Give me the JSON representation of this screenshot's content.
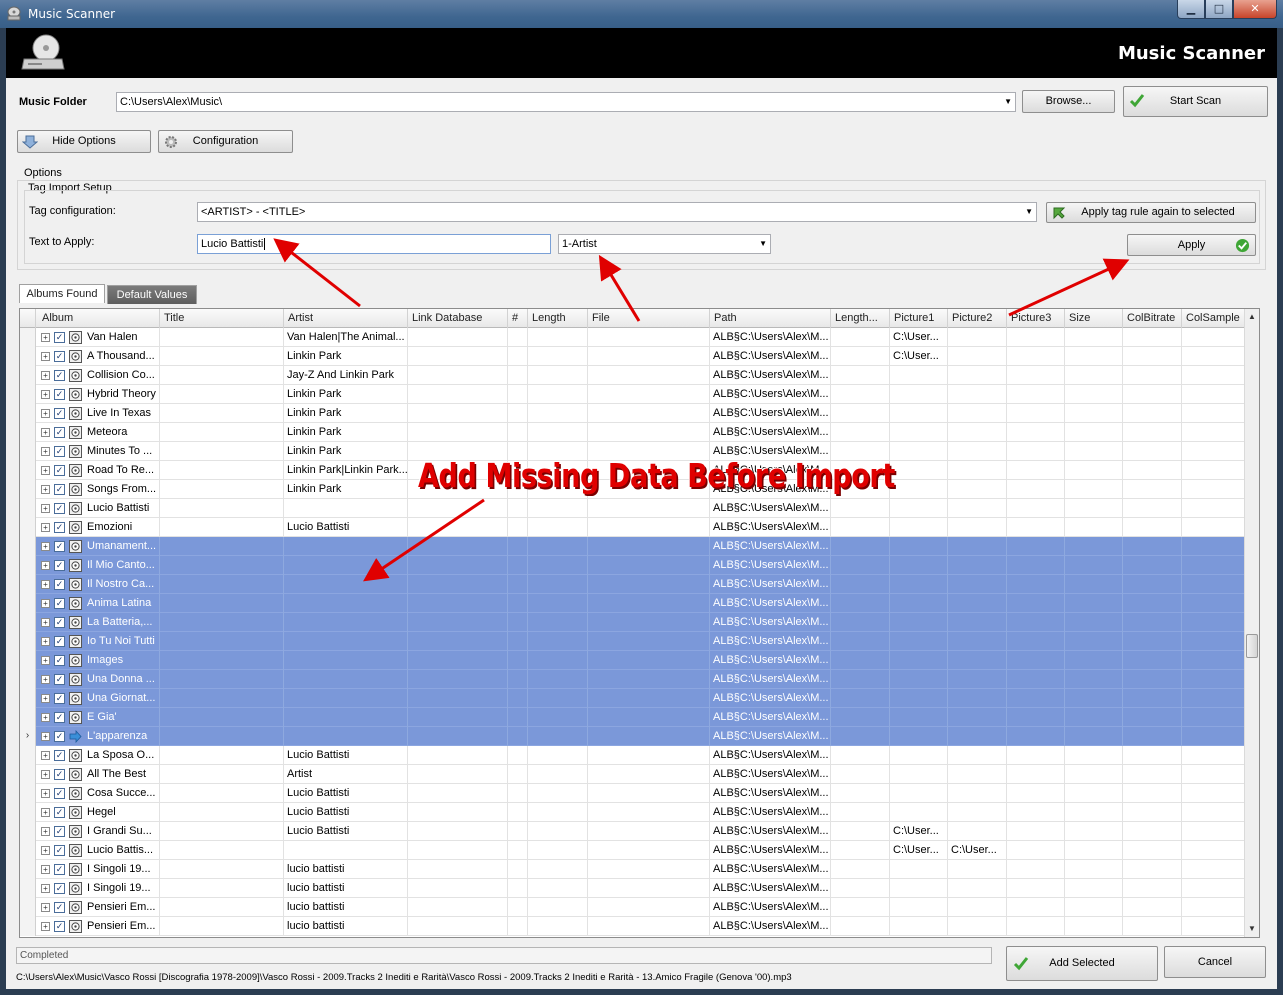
{
  "window": {
    "title": "Music Scanner"
  },
  "header": {
    "brand": "Music Scanner"
  },
  "folder": {
    "label": "Music Folder",
    "value": "C:\\Users\\Alex\\Music\\",
    "browse_label": "Browse...",
    "start_label": "Start Scan"
  },
  "toolbar": {
    "hide_options_label": "Hide Options",
    "configuration_label": "Configuration"
  },
  "options": {
    "title": "Options",
    "group_title": "Tag Import Setup",
    "tag_config_label": "Tag configuration:",
    "tag_config_value": "<ARTIST> - <TITLE>",
    "apply_again_label": "Apply tag rule again to selected",
    "text_apply_label": "Text to Apply:",
    "text_apply_value": "Lucio Battisti",
    "field_value": "1-Artist",
    "apply_label": "Apply"
  },
  "tabs": [
    {
      "label": "Albums Found"
    },
    {
      "label": "Default Values"
    }
  ],
  "grid": {
    "columns": [
      "Album",
      "Title",
      "Artist",
      "Link Database",
      "#",
      "Length",
      "File",
      "Path",
      "Length...",
      "Picture1",
      "Picture2",
      "Picture3",
      "Size",
      "ColBitrate",
      "ColSample"
    ],
    "rows": [
      {
        "album": "Van Halen",
        "artist": "Van Halen|The Animal...",
        "path": "ALB§C:\\Users\\Alex\\M...",
        "pic1": "C:\\User...",
        "pic2": "",
        "sel": false,
        "current": false
      },
      {
        "album": "A Thousand...",
        "artist": "Linkin Park",
        "path": "ALB§C:\\Users\\Alex\\M...",
        "pic1": "C:\\User...",
        "pic2": "",
        "sel": false,
        "current": false
      },
      {
        "album": "Collision Co...",
        "artist": "Jay-Z And Linkin Park",
        "path": "ALB§C:\\Users\\Alex\\M...",
        "pic1": "",
        "pic2": "",
        "sel": false,
        "current": false
      },
      {
        "album": "Hybrid Theory",
        "artist": "Linkin Park",
        "path": "ALB§C:\\Users\\Alex\\M...",
        "pic1": "",
        "pic2": "",
        "sel": false,
        "current": false
      },
      {
        "album": "Live In Texas",
        "artist": "Linkin Park",
        "path": "ALB§C:\\Users\\Alex\\M...",
        "pic1": "",
        "pic2": "",
        "sel": false,
        "current": false
      },
      {
        "album": "Meteora",
        "artist": "Linkin Park",
        "path": "ALB§C:\\Users\\Alex\\M...",
        "pic1": "",
        "pic2": "",
        "sel": false,
        "current": false
      },
      {
        "album": "Minutes To ...",
        "artist": "Linkin Park",
        "path": "ALB§C:\\Users\\Alex\\M...",
        "pic1": "",
        "pic2": "",
        "sel": false,
        "current": false
      },
      {
        "album": "Road To Re...",
        "artist": "Linkin Park|Linkin Park...",
        "path": "ALB§C:\\Users\\Alex\\M...",
        "pic1": "",
        "pic2": "",
        "sel": false,
        "current": false
      },
      {
        "album": "Songs From...",
        "artist": "Linkin Park",
        "path": "ALB§C:\\Users\\Alex\\M...",
        "pic1": "",
        "pic2": "",
        "sel": false,
        "current": false
      },
      {
        "album": "Lucio Battisti",
        "artist": "",
        "path": "ALB§C:\\Users\\Alex\\M...",
        "pic1": "",
        "pic2": "",
        "sel": false,
        "current": false
      },
      {
        "album": "Emozioni",
        "artist": "Lucio Battisti",
        "path": "ALB§C:\\Users\\Alex\\M...",
        "pic1": "",
        "pic2": "",
        "sel": false,
        "current": false
      },
      {
        "album": "Umanament...",
        "artist": "",
        "path": "ALB§C:\\Users\\Alex\\M...",
        "pic1": "",
        "pic2": "",
        "sel": true,
        "current": false
      },
      {
        "album": "Il Mio Canto...",
        "artist": "",
        "path": "ALB§C:\\Users\\Alex\\M...",
        "pic1": "",
        "pic2": "",
        "sel": true,
        "current": false
      },
      {
        "album": "Il Nostro Ca...",
        "artist": "",
        "path": "ALB§C:\\Users\\Alex\\M...",
        "pic1": "",
        "pic2": "",
        "sel": true,
        "current": false
      },
      {
        "album": "Anima Latina",
        "artist": "",
        "path": "ALB§C:\\Users\\Alex\\M...",
        "pic1": "",
        "pic2": "",
        "sel": true,
        "current": false
      },
      {
        "album": "La Batteria,...",
        "artist": "",
        "path": "ALB§C:\\Users\\Alex\\M...",
        "pic1": "",
        "pic2": "",
        "sel": true,
        "current": false
      },
      {
        "album": "Io Tu Noi Tutti",
        "artist": "",
        "path": "ALB§C:\\Users\\Alex\\M...",
        "pic1": "",
        "pic2": "",
        "sel": true,
        "current": false
      },
      {
        "album": "Images",
        "artist": "",
        "path": "ALB§C:\\Users\\Alex\\M...",
        "pic1": "",
        "pic2": "",
        "sel": true,
        "current": false
      },
      {
        "album": "Una Donna ...",
        "artist": "",
        "path": "ALB§C:\\Users\\Alex\\M...",
        "pic1": "",
        "pic2": "",
        "sel": true,
        "current": false
      },
      {
        "album": "Una Giornat...",
        "artist": "",
        "path": "ALB§C:\\Users\\Alex\\M...",
        "pic1": "",
        "pic2": "",
        "sel": true,
        "current": false
      },
      {
        "album": "E Gia'",
        "artist": "",
        "path": "ALB§C:\\Users\\Alex\\M...",
        "pic1": "",
        "pic2": "",
        "sel": true,
        "current": false
      },
      {
        "album": "L'apparenza",
        "artist": "",
        "path": "ALB§C:\\Users\\Alex\\M...",
        "pic1": "",
        "pic2": "",
        "sel": true,
        "current": true
      },
      {
        "album": "La Sposa O...",
        "artist": "Lucio Battisti",
        "path": "ALB§C:\\Users\\Alex\\M...",
        "pic1": "",
        "pic2": "",
        "sel": false,
        "current": false
      },
      {
        "album": "All The Best",
        "artist": "Artist",
        "path": "ALB§C:\\Users\\Alex\\M...",
        "pic1": "",
        "pic2": "",
        "sel": false,
        "current": false
      },
      {
        "album": "Cosa Succe...",
        "artist": "Lucio Battisti",
        "path": "ALB§C:\\Users\\Alex\\M...",
        "pic1": "",
        "pic2": "",
        "sel": false,
        "current": false
      },
      {
        "album": "Hegel",
        "artist": "Lucio Battisti",
        "path": "ALB§C:\\Users\\Alex\\M...",
        "pic1": "",
        "pic2": "",
        "sel": false,
        "current": false
      },
      {
        "album": "I Grandi Su...",
        "artist": "Lucio Battisti",
        "path": "ALB§C:\\Users\\Alex\\M...",
        "pic1": "C:\\User...",
        "pic2": "",
        "sel": false,
        "current": false
      },
      {
        "album": "Lucio Battis...",
        "artist": "",
        "path": "ALB§C:\\Users\\Alex\\M...",
        "pic1": "C:\\User...",
        "pic2": "C:\\User...",
        "sel": false,
        "current": false
      },
      {
        "album": "I Singoli 19...",
        "artist": "lucio battisti",
        "path": "ALB§C:\\Users\\Alex\\M...",
        "pic1": "",
        "pic2": "",
        "sel": false,
        "current": false
      },
      {
        "album": "I Singoli 19...",
        "artist": "lucio battisti",
        "path": "ALB§C:\\Users\\Alex\\M...",
        "pic1": "",
        "pic2": "",
        "sel": false,
        "current": false
      },
      {
        "album": "Pensieri Em...",
        "artist": "lucio battisti",
        "path": "ALB§C:\\Users\\Alex\\M...",
        "pic1": "",
        "pic2": "",
        "sel": false,
        "current": false
      },
      {
        "album": "Pensieri Em...",
        "artist": "lucio battisti",
        "path": "ALB§C:\\Users\\Alex\\M...",
        "pic1": "",
        "pic2": "",
        "sel": false,
        "current": false
      }
    ]
  },
  "annotation": {
    "text": "Add Missing Data Before Import"
  },
  "status": {
    "text": "Completed",
    "path": "C:\\Users\\Alex\\Music\\Vasco Rossi [Discografia 1978-2009]\\Vasco Rossi - 2009.Tracks 2 Inediti e Rarità\\Vasco Rossi - 2009.Tracks 2 Inediti e Rarità - 13.Amico Fragile (Genova '00).mp3"
  },
  "footer": {
    "add_selected_label": "Add Selected",
    "cancel_label": "Cancel"
  },
  "colors": {
    "selection": "#7b98d9",
    "annotation": "#e00000",
    "header_bg": "#000000"
  }
}
